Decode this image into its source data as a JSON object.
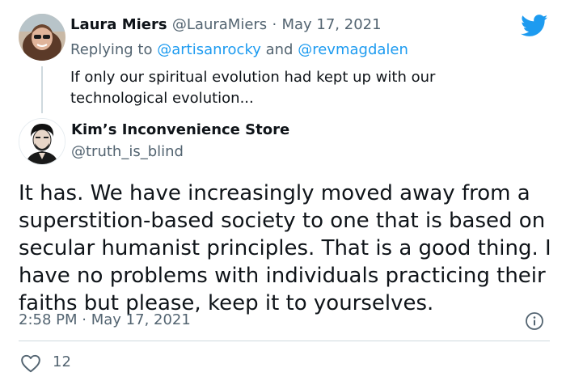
{
  "reply_tweet": {
    "name": "Laura Miers",
    "handle": "@LauraMiers",
    "separator": "·",
    "date": "May 17, 2021",
    "replying_prefix": "Replying to",
    "mention1": "@artisanrocky",
    "conjunction": "and",
    "mention2": "@revmagdalen",
    "text": "If only our spiritual evolution had kept up with our technological evolution..."
  },
  "main_tweet": {
    "name": "Kim’s Inconvenience Store",
    "handle": "@truth_is_blind",
    "text": "It has. We have increasingly moved away from a superstition-based society to one that is based on secular humanist principles. That is a good thing. I have no problems with individuals practicing their faiths but please, keep it to yourselves.",
    "time": "2:58 PM",
    "separator": "·",
    "date": "May 17, 2021",
    "like_count": "12"
  },
  "colors": {
    "text_primary": "#0f1419",
    "text_secondary": "#536471",
    "link": "#1d9bf0",
    "twitter_blue": "#1d9bf0",
    "divider": "#cfd9de"
  },
  "icons": {
    "brand": "twitter-bird-icon",
    "info": "info-icon",
    "like": "heart-icon"
  }
}
